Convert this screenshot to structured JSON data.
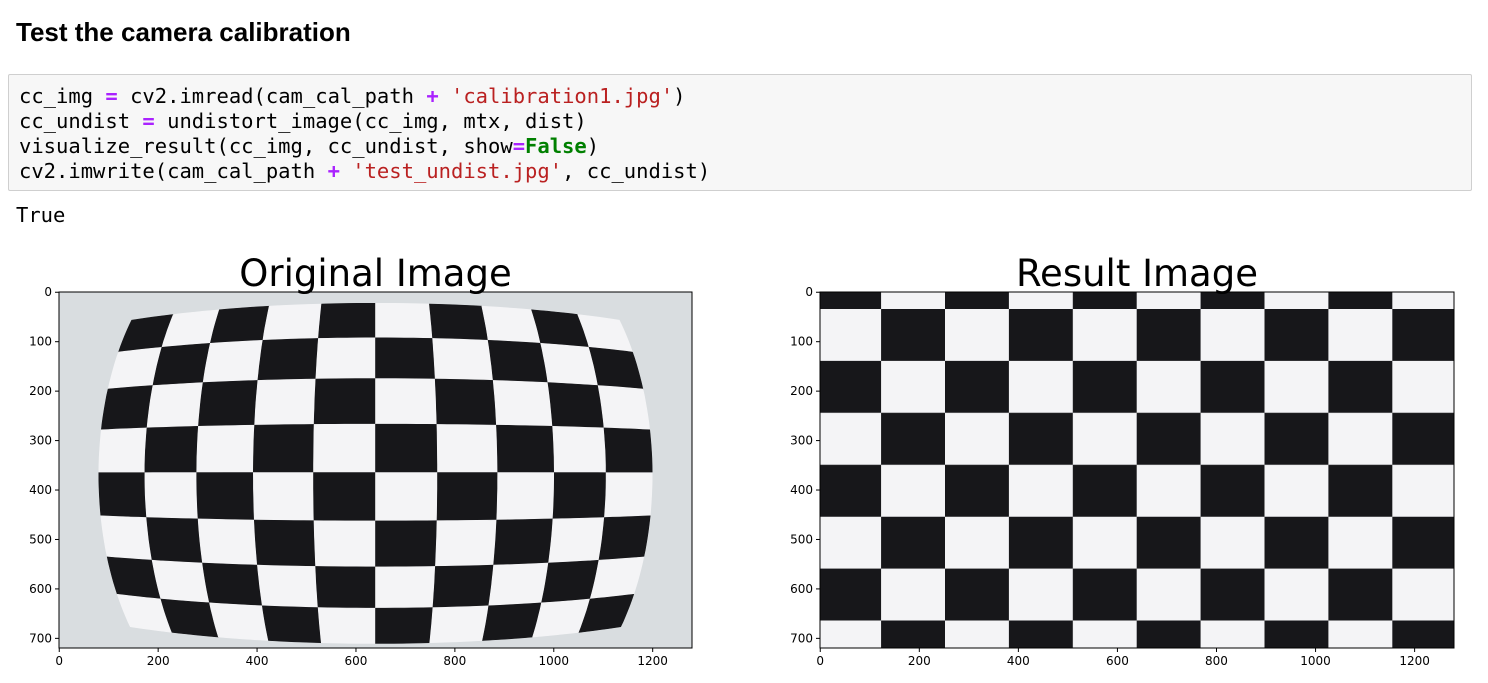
{
  "heading": "Test the camera calibration",
  "code_cell": {
    "lines": [
      [
        {
          "t": "cc_img "
        },
        {
          "t": "=",
          "c": "op"
        },
        {
          "t": " cv2.imread(cam_cal_path "
        },
        {
          "t": "+",
          "c": "op"
        },
        {
          "t": " "
        },
        {
          "t": "'calibration1.jpg'",
          "c": "str"
        },
        {
          "t": ")"
        }
      ],
      [
        {
          "t": "cc_undist "
        },
        {
          "t": "=",
          "c": "op"
        },
        {
          "t": " undistort_image(cc_img, mtx, dist)"
        }
      ],
      [
        {
          "t": "visualize_result(cc_img, cc_undist, show"
        },
        {
          "t": "=",
          "c": "op"
        },
        {
          "t": "False",
          "c": "kw"
        },
        {
          "t": ")"
        }
      ],
      [
        {
          "t": "cv2.imwrite(cam_cal_path "
        },
        {
          "t": "+",
          "c": "op"
        },
        {
          "t": " "
        },
        {
          "t": "'test_undist.jpg'",
          "c": "str"
        },
        {
          "t": ", cc_undist)"
        }
      ]
    ]
  },
  "output": {
    "text": "True"
  },
  "figure": {
    "panels": [
      {
        "title": "Original Image",
        "distorted": true
      },
      {
        "title": "Result Image",
        "distorted": false
      }
    ],
    "x_ticks": [
      "0",
      "200",
      "400",
      "600",
      "800",
      "1000",
      "1200"
    ],
    "y_ticks": [
      "0",
      "100",
      "200",
      "300",
      "400",
      "500",
      "600",
      "700"
    ]
  },
  "colors": {
    "background": "#ffffff",
    "cell_bg": "#f7f7f7",
    "operator": "#aa22ff",
    "string": "#ba2121",
    "keyword": "#008000"
  }
}
